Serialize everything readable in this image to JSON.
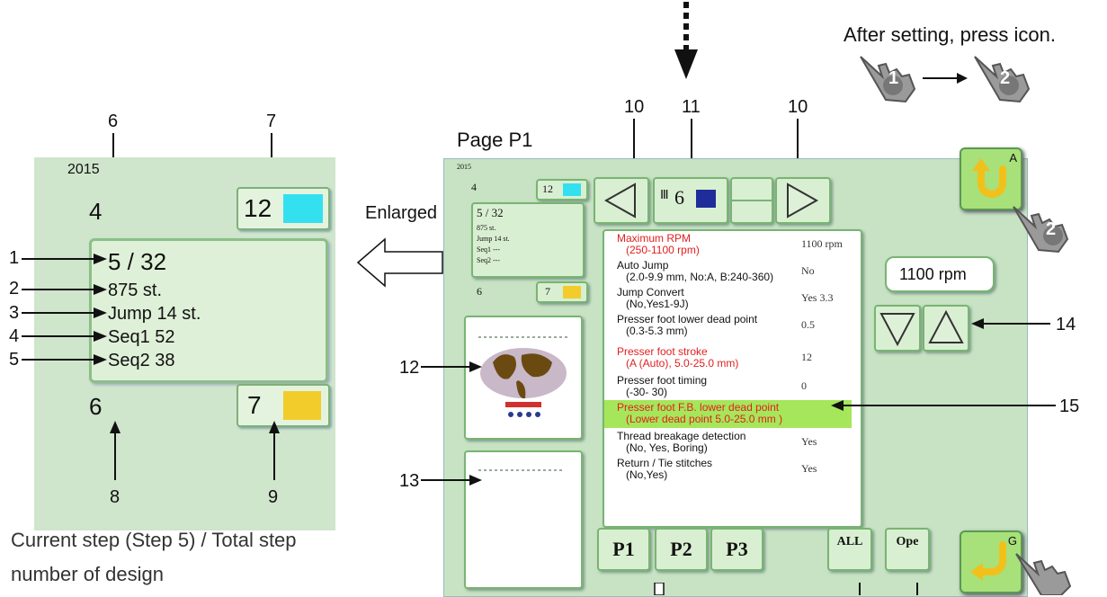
{
  "top_note": "After setting, press icon.",
  "hand_labels": [
    "1",
    "2"
  ],
  "enlarged_label": "Enlarged",
  "page_label": "Page P1",
  "callouts": {
    "c1": "1",
    "c2": "2",
    "c3": "3",
    "c4": "4",
    "c5": "5",
    "c6": "6",
    "c7": "7",
    "c8": "8",
    "c9": "9",
    "c10a": "10",
    "c10b": "10",
    "c11": "11",
    "c12": "12",
    "c13": "13",
    "c14": "14",
    "c15": "15"
  },
  "enlarged": {
    "year": "2015",
    "top_left": "4",
    "top_right": "12",
    "step": "5 / 32",
    "stitches": "875 st.",
    "jump": "Jump 14 st.",
    "seq1": "Seq1 52",
    "seq2": "Seq2 38",
    "bottom_left": "6",
    "bottom_right": "7",
    "colors": {
      "top": "#33e0f0",
      "bottom": "#f2cc2a"
    }
  },
  "screen": {
    "year": "2015",
    "top_left": "4",
    "top_right": "12",
    "step": "5 / 32",
    "stitches": "875 st.",
    "jump": "Jump 14 st.",
    "seq1": "Seq1  ---",
    "seq2": "Seq2  ---",
    "bottom_left": "6",
    "bottom_right": "7",
    "needle": "6",
    "rpm_display": "1100 rpm",
    "tabs": [
      "P1",
      "P2",
      "P3"
    ],
    "all_btn": "ALL",
    "ope_btn": "Ope",
    "btn_a_letter": "A",
    "btn_g_letter": "G"
  },
  "settings": [
    {
      "label": "Maximum RPM",
      "range": "(250-1100 rpm)",
      "value": "1100 rpm",
      "red": true
    },
    {
      "label": "Auto Jump",
      "range": "(2.0-9.9 mm, No:A, B:240-360)",
      "value": "No",
      "red": false
    },
    {
      "label": "Jump Convert",
      "range": "(No,Yes1-9J)",
      "value": "Yes 3.3",
      "red": false
    },
    {
      "label": "Presser foot lower dead point",
      "range": "(0.3-5.3 mm)",
      "value": "0.5",
      "red": false
    },
    {
      "label": "Presser foot stroke",
      "range": "(A (Auto), 5.0-25.0 mm)",
      "value": "12",
      "red": true
    },
    {
      "label": "Presser foot timing",
      "range": "(-30- 30)",
      "value": "0",
      "red": false
    },
    {
      "label": "Presser foot F.B. lower dead point",
      "range": "(Lower dead point 5.0-25.0 mm )",
      "value": "",
      "red": true
    },
    {
      "label": "Thread breakage detection",
      "range": "(No, Yes, Boring)",
      "value": "Yes",
      "red": false
    },
    {
      "label": "Return / Tie stitches",
      "range": "(No,Yes)",
      "value": "Yes",
      "red": false
    }
  ],
  "bottom_text": [
    "Current step (Step 5) / Total step",
    "number of design"
  ]
}
